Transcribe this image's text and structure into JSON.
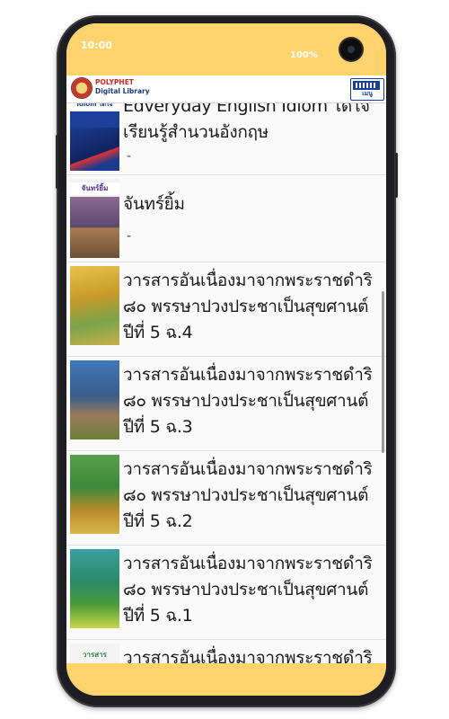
{
  "status": {
    "time": "10:00",
    "battery": "100%"
  },
  "app": {
    "logo_line1": "POLYPHET",
    "logo_line2": "Digital Library",
    "menu_label": "เมนู"
  },
  "items": [
    {
      "title": "Edveryday English Idiom ได้ใจ เรียนรู้สำนวนอังกฤษ",
      "subtitle": "-",
      "cover_text": "Idiom ได้ใจ"
    },
    {
      "title": "จันทร์ยิ้ม",
      "subtitle": "-",
      "cover_text": "จันทร์ยิ้ม"
    },
    {
      "title": "วารสารอันเนื่องมาจากพระราชดำริ ๘๐ พรรษาปวงประชาเป็นสุขศานต์ ปีที่ 5 ฉ.4",
      "subtitle": "-",
      "cover_text": ""
    },
    {
      "title": "วารสารอันเนื่องมาจากพระราชดำริ ๘๐ พรรษาปวงประชาเป็นสุขศานต์ ปีที่ 5 ฉ.3",
      "subtitle": "-",
      "cover_text": ""
    },
    {
      "title": "วารสารอันเนื่องมาจากพระราชดำริ ๘๐ พรรษาปวงประชาเป็นสุขศานต์ ปีที่ 5 ฉ.2",
      "subtitle": "-",
      "cover_text": ""
    },
    {
      "title": "วารสารอันเนื่องมาจากพระราชดำริ ๘๐ พรรษาปวงประชาเป็นสุขศานต์ ปีที่ 5 ฉ.1",
      "subtitle": "-",
      "cover_text": ""
    },
    {
      "title": "วารสารอันเนื่องมาจากพระราชดำริ",
      "subtitle": "",
      "cover_text": "วารสาร"
    }
  ],
  "colors": {
    "status_bar": "#fdd36e",
    "accent": "#1a3e9c",
    "brand_red": "#d12a1e"
  }
}
